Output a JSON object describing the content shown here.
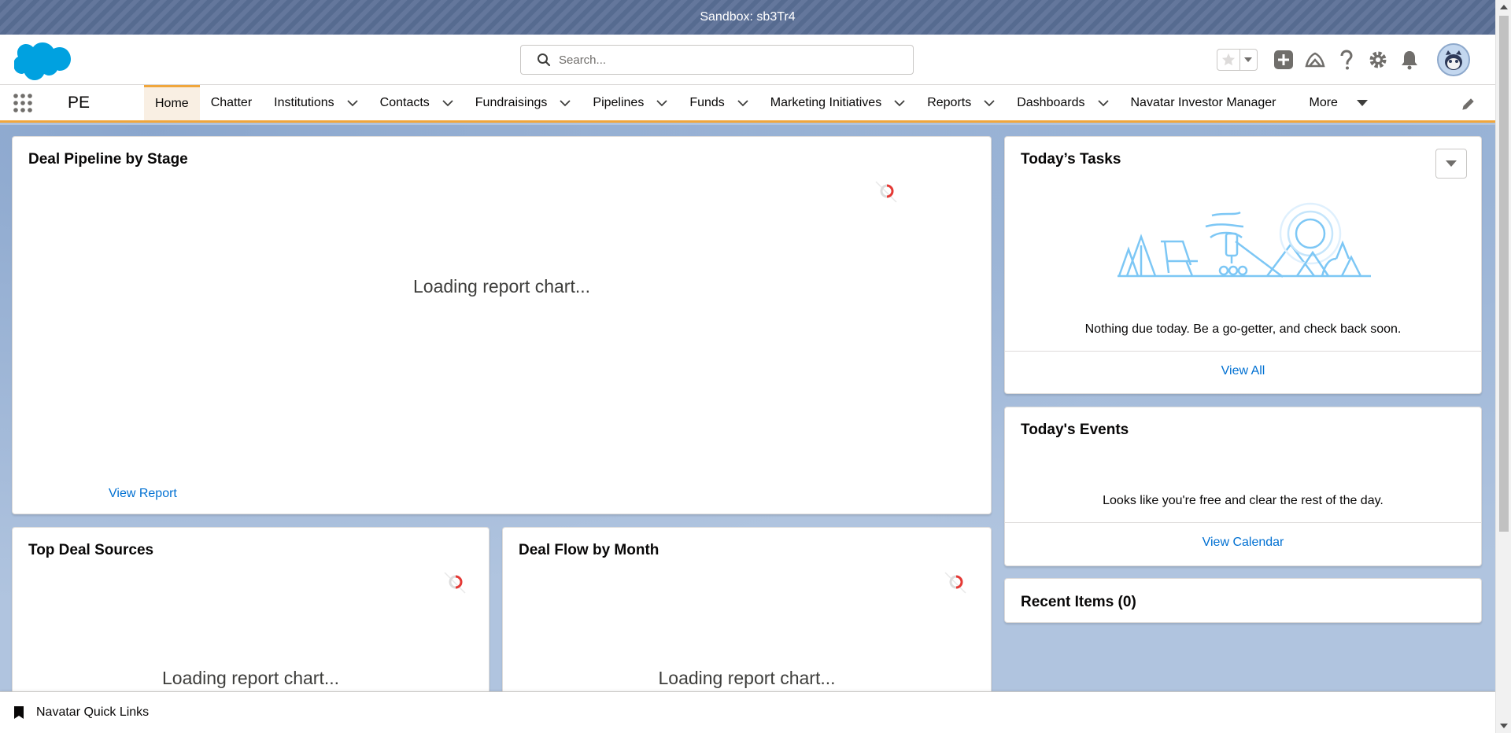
{
  "sandbox": {
    "label": "Sandbox: sb3Tr4"
  },
  "search": {
    "placeholder": "Search..."
  },
  "app": {
    "name": "PE"
  },
  "nav": {
    "items": [
      {
        "label": "Home",
        "active": true,
        "dropdown": false
      },
      {
        "label": "Chatter",
        "active": false,
        "dropdown": false
      },
      {
        "label": "Institutions",
        "active": false,
        "dropdown": true
      },
      {
        "label": "Contacts",
        "active": false,
        "dropdown": true
      },
      {
        "label": "Fundraisings",
        "active": false,
        "dropdown": true
      },
      {
        "label": "Pipelines",
        "active": false,
        "dropdown": true
      },
      {
        "label": "Funds",
        "active": false,
        "dropdown": true
      },
      {
        "label": "Marketing Initiatives",
        "active": false,
        "dropdown": true
      },
      {
        "label": "Reports",
        "active": false,
        "dropdown": true
      },
      {
        "label": "Dashboards",
        "active": false,
        "dropdown": true
      },
      {
        "label": "Navatar Investor Manager",
        "active": false,
        "dropdown": false
      }
    ],
    "more_label": "More"
  },
  "cards": {
    "pipeline": {
      "title": "Deal Pipeline by Stage",
      "loading": "Loading report chart...",
      "link": "View Report"
    },
    "sources": {
      "title": "Top Deal Sources",
      "loading": "Loading report chart..."
    },
    "flow": {
      "title": "Deal Flow by Month",
      "loading": "Loading report chart..."
    },
    "tasks": {
      "title": "Today’s Tasks",
      "message": "Nothing due today. Be a go-getter, and check back soon.",
      "link": "View All"
    },
    "events": {
      "title": "Today's Events",
      "message": "Looks like you're free and clear the rest of the day.",
      "link": "View Calendar"
    },
    "recent": {
      "title": "Recent Items (0)"
    }
  },
  "utility_bar": {
    "label": "Navatar Quick Links"
  },
  "colors": {
    "brand": "#00a1e0",
    "link": "#0070d2",
    "nav_accent": "#f0a63c",
    "sandbox_bar": "#5a6f96"
  },
  "icons": [
    "salesforce-cloud-logo",
    "search-icon",
    "star-icon",
    "chevron-down-icon",
    "plus-icon",
    "trailhead-icon",
    "help-icon",
    "gear-icon",
    "bell-icon",
    "avatar",
    "app-launcher-icon",
    "pencil-icon",
    "bookmark-icon"
  ]
}
